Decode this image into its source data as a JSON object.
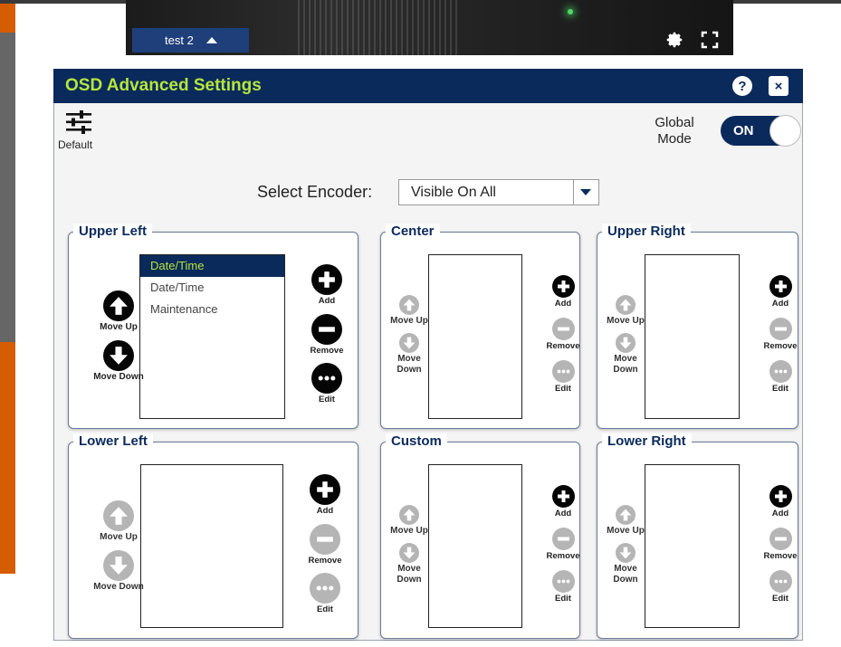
{
  "stream": {
    "tab_label": "test 2"
  },
  "video_icons": {
    "settings": "gear-icon",
    "fullscreen": "fullscreen-icon"
  },
  "dialog": {
    "title": "OSD Advanced Settings",
    "help_label": "?",
    "close_label": "×",
    "default_label": "Default",
    "global_mode_label_line1": "Global",
    "global_mode_label_line2": "Mode",
    "global_mode_value": "ON",
    "select_encoder_label": "Select Encoder:",
    "select_encoder_value": "Visible On All"
  },
  "labels": {
    "move_up": "Move Up",
    "move_down": "Move Down",
    "move_word": "Move",
    "down_word": "Down",
    "add": "Add",
    "remove": "Remove",
    "edit": "Edit"
  },
  "panels": [
    {
      "id": "upper-left",
      "title": "Upper Left",
      "items": [
        "Date/Time",
        "Date/Time",
        "Maintenance"
      ],
      "selected_index": 0
    },
    {
      "id": "center",
      "title": "Center",
      "items": []
    },
    {
      "id": "upper-right",
      "title": "Upper Right",
      "items": []
    },
    {
      "id": "lower-left",
      "title": "Lower Left",
      "items": []
    },
    {
      "id": "custom",
      "title": "Custom",
      "items": []
    },
    {
      "id": "lower-right",
      "title": "Lower Right",
      "items": []
    }
  ],
  "colors": {
    "header_bg": "#0b2a5c",
    "title_text": "#b6e63a",
    "accent_orange": "#d65c00"
  }
}
